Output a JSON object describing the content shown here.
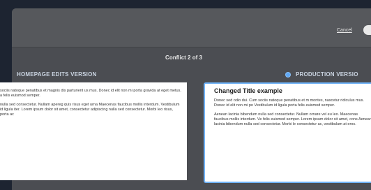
{
  "header": {
    "cancel_label": "Cancel"
  },
  "conflict_label": "Conflict 2 of 3",
  "versions": {
    "left_label": "HOMEPAGE EDITS VERSION",
    "right_label": "PRODUCTION VERSIO"
  },
  "left_pane": {
    "paragraphs": [
      "sociis natoque penatibus et magnis dis parturient us mus. Donec id elit non mi porta gravida at eget metus. a felis euismod semper.",
      "nulla sed consectetur. Nullam apereg quis risus eget urna Maecenas faucibus mollis interdum. Vestibulum id ligula iter. Lorem ipsum dolor sit amet, consectetur adipiscing nulla sed consectetur. Morbi leo risus, porta ac"
    ]
  },
  "right_pane": {
    "title": "Changed Title example",
    "paragraphs": [
      "Donec sed odio dui. Cum sociis natoque penatibus et m montes, nascetur ridiculus mus. Donec id elit non mi po Vestibulum id ligula porta felis euismod semper.",
      "Aenean lacinia bibendum nulla sed consectetur. Nullam ornare vel eu leo. Maecenas faucibus mollis interdum. Ve felis euismod semper. Lorem ipsum dolor sit amet, cons Aenean lacinia bibendum nulla sed consectetur. Morbi le consectetur ac, vestibulum at eros."
    ]
  },
  "colors": {
    "accent": "#5fa8f5",
    "background": "#1d2431",
    "dialog": "#4b4d52"
  }
}
